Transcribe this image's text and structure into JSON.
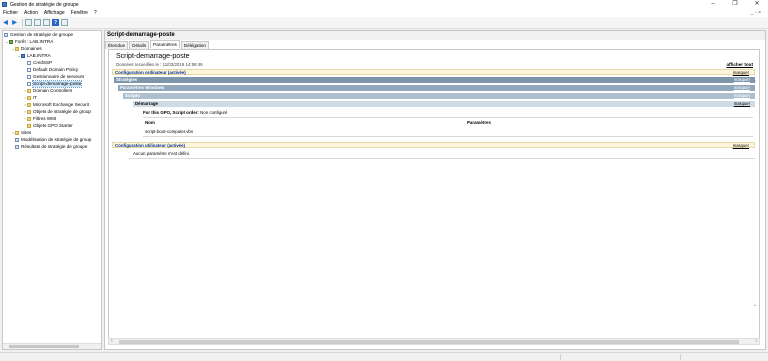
{
  "window": {
    "title": "Gestion de stratégie de groupe",
    "controls": [
      "–",
      "❐",
      "✕"
    ]
  },
  "menu": {
    "items": [
      "Fichier",
      "Action",
      "Affichage",
      "Fenêtre",
      "?"
    ],
    "right": "_ ▫ ×"
  },
  "tree": {
    "root": "Gestion de stratégie de groupe",
    "forest": "Forêt : LAB.INTRA",
    "domains": "Domaines",
    "domain": "LAB.INTRA",
    "items": [
      "CredSSP",
      "Default Domain Policy",
      "Gestionnaire de serveurs",
      "Script-demarrage-poste",
      "Domain Controllers",
      "IT",
      "Microsoft Exchange Securit",
      "Objets de stratégie de group",
      "Filtres WMI",
      "Objets GPO Starter"
    ],
    "sites": "Sites",
    "modelisation": "Modélisation de stratégie de group",
    "resultats": "Résultats de stratégie de groupe"
  },
  "pane": {
    "header": "Script-demarrage-poste",
    "tabs": [
      "Étendue",
      "Détails",
      "Paramètres",
      "Délégation"
    ],
    "active_tab": "Paramètres"
  },
  "report": {
    "title": "Script-demarrage-poste",
    "collected": "Données recueillies le : 11/03/2019 14:59:49",
    "show_all": "afficher tout",
    "hide": "masquer",
    "computer_config": "Configuration ordinateur (activée)",
    "policies": "Stratégies",
    "windows_settings": "Paramètres Windows",
    "scripts": "Scripts",
    "startup": "Démarrage",
    "order_label": "For this GPO, Script order:",
    "order_value": "Non configuré",
    "col_name": "Nom",
    "col_params": "Paramètres",
    "script_name": "script-boot-computer.vbs",
    "user_config": "Configuration utilisateur (activée)",
    "no_settings": "Aucun paramètre n'est défini."
  }
}
